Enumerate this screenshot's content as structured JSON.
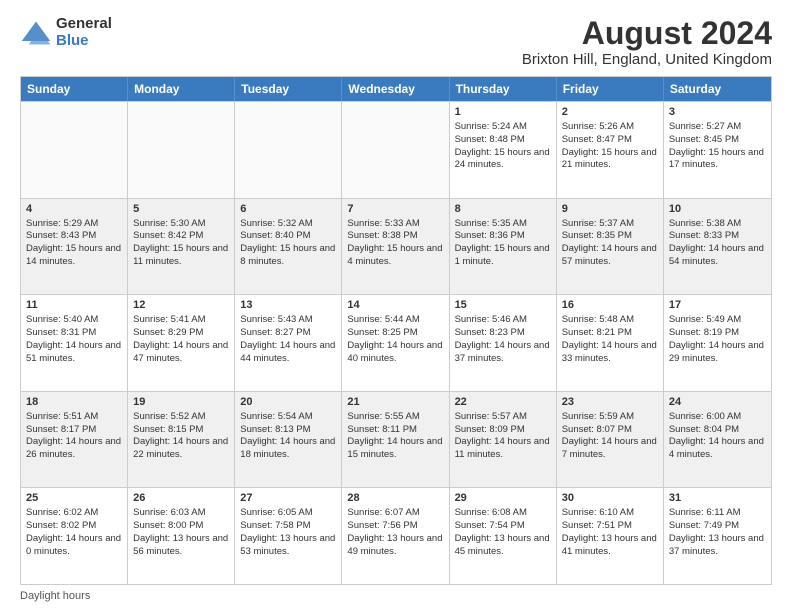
{
  "logo": {
    "general": "General",
    "blue": "Blue"
  },
  "header": {
    "title": "August 2024",
    "subtitle": "Brixton Hill, England, United Kingdom"
  },
  "days": [
    "Sunday",
    "Monday",
    "Tuesday",
    "Wednesday",
    "Thursday",
    "Friday",
    "Saturday"
  ],
  "footer": "Daylight hours",
  "weeks": [
    [
      {
        "day": "",
        "content": ""
      },
      {
        "day": "",
        "content": ""
      },
      {
        "day": "",
        "content": ""
      },
      {
        "day": "",
        "content": ""
      },
      {
        "day": "1",
        "content": "Sunrise: 5:24 AM\nSunset: 8:48 PM\nDaylight: 15 hours and 24 minutes."
      },
      {
        "day": "2",
        "content": "Sunrise: 5:26 AM\nSunset: 8:47 PM\nDaylight: 15 hours and 21 minutes."
      },
      {
        "day": "3",
        "content": "Sunrise: 5:27 AM\nSunset: 8:45 PM\nDaylight: 15 hours and 17 minutes."
      }
    ],
    [
      {
        "day": "4",
        "content": "Sunrise: 5:29 AM\nSunset: 8:43 PM\nDaylight: 15 hours and 14 minutes."
      },
      {
        "day": "5",
        "content": "Sunrise: 5:30 AM\nSunset: 8:42 PM\nDaylight: 15 hours and 11 minutes."
      },
      {
        "day": "6",
        "content": "Sunrise: 5:32 AM\nSunset: 8:40 PM\nDaylight: 15 hours and 8 minutes."
      },
      {
        "day": "7",
        "content": "Sunrise: 5:33 AM\nSunset: 8:38 PM\nDaylight: 15 hours and 4 minutes."
      },
      {
        "day": "8",
        "content": "Sunrise: 5:35 AM\nSunset: 8:36 PM\nDaylight: 15 hours and 1 minute."
      },
      {
        "day": "9",
        "content": "Sunrise: 5:37 AM\nSunset: 8:35 PM\nDaylight: 14 hours and 57 minutes."
      },
      {
        "day": "10",
        "content": "Sunrise: 5:38 AM\nSunset: 8:33 PM\nDaylight: 14 hours and 54 minutes."
      }
    ],
    [
      {
        "day": "11",
        "content": "Sunrise: 5:40 AM\nSunset: 8:31 PM\nDaylight: 14 hours and 51 minutes."
      },
      {
        "day": "12",
        "content": "Sunrise: 5:41 AM\nSunset: 8:29 PM\nDaylight: 14 hours and 47 minutes."
      },
      {
        "day": "13",
        "content": "Sunrise: 5:43 AM\nSunset: 8:27 PM\nDaylight: 14 hours and 44 minutes."
      },
      {
        "day": "14",
        "content": "Sunrise: 5:44 AM\nSunset: 8:25 PM\nDaylight: 14 hours and 40 minutes."
      },
      {
        "day": "15",
        "content": "Sunrise: 5:46 AM\nSunset: 8:23 PM\nDaylight: 14 hours and 37 minutes."
      },
      {
        "day": "16",
        "content": "Sunrise: 5:48 AM\nSunset: 8:21 PM\nDaylight: 14 hours and 33 minutes."
      },
      {
        "day": "17",
        "content": "Sunrise: 5:49 AM\nSunset: 8:19 PM\nDaylight: 14 hours and 29 minutes."
      }
    ],
    [
      {
        "day": "18",
        "content": "Sunrise: 5:51 AM\nSunset: 8:17 PM\nDaylight: 14 hours and 26 minutes."
      },
      {
        "day": "19",
        "content": "Sunrise: 5:52 AM\nSunset: 8:15 PM\nDaylight: 14 hours and 22 minutes."
      },
      {
        "day": "20",
        "content": "Sunrise: 5:54 AM\nSunset: 8:13 PM\nDaylight: 14 hours and 18 minutes."
      },
      {
        "day": "21",
        "content": "Sunrise: 5:55 AM\nSunset: 8:11 PM\nDaylight: 14 hours and 15 minutes."
      },
      {
        "day": "22",
        "content": "Sunrise: 5:57 AM\nSunset: 8:09 PM\nDaylight: 14 hours and 11 minutes."
      },
      {
        "day": "23",
        "content": "Sunrise: 5:59 AM\nSunset: 8:07 PM\nDaylight: 14 hours and 7 minutes."
      },
      {
        "day": "24",
        "content": "Sunrise: 6:00 AM\nSunset: 8:04 PM\nDaylight: 14 hours and 4 minutes."
      }
    ],
    [
      {
        "day": "25",
        "content": "Sunrise: 6:02 AM\nSunset: 8:02 PM\nDaylight: 14 hours and 0 minutes."
      },
      {
        "day": "26",
        "content": "Sunrise: 6:03 AM\nSunset: 8:00 PM\nDaylight: 13 hours and 56 minutes."
      },
      {
        "day": "27",
        "content": "Sunrise: 6:05 AM\nSunset: 7:58 PM\nDaylight: 13 hours and 53 minutes."
      },
      {
        "day": "28",
        "content": "Sunrise: 6:07 AM\nSunset: 7:56 PM\nDaylight: 13 hours and 49 minutes."
      },
      {
        "day": "29",
        "content": "Sunrise: 6:08 AM\nSunset: 7:54 PM\nDaylight: 13 hours and 45 minutes."
      },
      {
        "day": "30",
        "content": "Sunrise: 6:10 AM\nSunset: 7:51 PM\nDaylight: 13 hours and 41 minutes."
      },
      {
        "day": "31",
        "content": "Sunrise: 6:11 AM\nSunset: 7:49 PM\nDaylight: 13 hours and 37 minutes."
      }
    ]
  ]
}
